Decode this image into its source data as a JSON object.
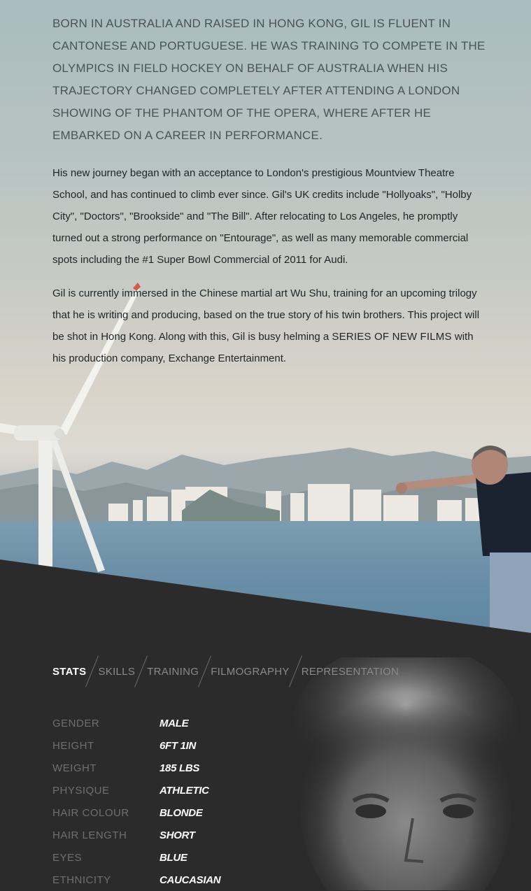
{
  "bio": {
    "lead": "Born in Australia and raised in Hong Kong, Gil is fluent in Cantonese and Portuguese. He was training to compete in the Olympics in field hockey on behalf of Australia when his trajectory changed completely after attending a London showing of The Phantom of the Opera, where after he embarked on a career in performance.",
    "para1": "His new journey began with an acceptance to London's prestigious Mountview Theatre School, and has continued to climb ever since. Gil's UK credits include \"Hollyoaks\", \"Holby City\", \"Doctors\", \"Brookside\" and \"The Bill\". After relocating to Los Angeles, he promptly turned out a strong performance on \"Entourage\", as well as many memorable commercial spots including the #1 Super Bowl Commercial of 2011 for Audi.",
    "para2_start": "Gil is currently immersed in the Chinese martial art Wu Shu, training for an upcoming trilogy that he is writing and producing, based on the true story of his twin brothers. This project will be shot in Hong Kong. Along with this, Gil is busy helming a ",
    "para2_link": "Series of New Films",
    "para2_end": " with his production company, Exchange Entertainment."
  },
  "tabs": [
    {
      "label": "Stats",
      "active": true
    },
    {
      "label": "Skills",
      "active": false
    },
    {
      "label": "Training",
      "active": false
    },
    {
      "label": "Filmography",
      "active": false
    },
    {
      "label": "Representation",
      "active": false
    }
  ],
  "stats": [
    {
      "label": "Gender",
      "value": "Male"
    },
    {
      "label": "Height",
      "value": "6ft 1in"
    },
    {
      "label": "Weight",
      "value": "185 lbs"
    },
    {
      "label": "Physique",
      "value": "Athletic"
    },
    {
      "label": "Hair Colour",
      "value": "Blonde"
    },
    {
      "label": "Hair Length",
      "value": "Short"
    },
    {
      "label": "Eyes",
      "value": "Blue"
    },
    {
      "label": "Ethnicity",
      "value": "Caucasian"
    }
  ],
  "colors": {
    "dark_bg": "#2b2b2b",
    "tab_active": "#ffffff",
    "tab_inactive": "#8a8a8a",
    "stat_label": "#6f6f6f",
    "stat_value": "#ffffff"
  }
}
